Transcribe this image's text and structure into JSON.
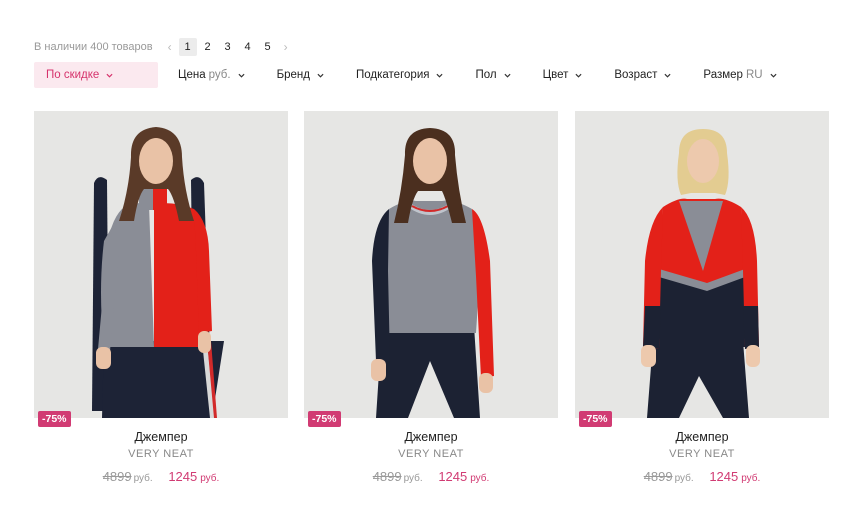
{
  "toolbar": {
    "count_text": "В наличии 400 товаров",
    "prev_arrow": "‹",
    "next_arrow": "›",
    "pages": [
      "1",
      "2",
      "3",
      "4",
      "5"
    ],
    "current_page": "1"
  },
  "filters": [
    {
      "label": "По скидке",
      "unit": ""
    },
    {
      "label": "Цена",
      "unit": "руб."
    },
    {
      "label": "Бренд",
      "unit": ""
    },
    {
      "label": "Подкатегория",
      "unit": ""
    },
    {
      "label": "Пол",
      "unit": ""
    },
    {
      "label": "Цвет",
      "unit": ""
    },
    {
      "label": "Возраст",
      "unit": ""
    },
    {
      "label": "Размер",
      "unit": "RU"
    }
  ],
  "products": [
    {
      "badge": "-75%",
      "name": "Джемпер",
      "brand": "VERY NEAT",
      "old_price": "4899",
      "old_currency": "руб.",
      "new_price": "1245",
      "new_currency": "руб."
    },
    {
      "badge": "-75%",
      "name": "Джемпер",
      "brand": "VERY NEAT",
      "old_price": "4899",
      "old_currency": "руб.",
      "new_price": "1245",
      "new_currency": "руб."
    },
    {
      "badge": "-75%",
      "name": "Джемпер",
      "brand": "VERY NEAT",
      "old_price": "4899",
      "old_currency": "руб.",
      "new_price": "1245",
      "new_currency": "руб."
    }
  ],
  "colors": {
    "accent": "#d13b73",
    "accent_bg": "#fbe9ef",
    "photo_bg": "#e6e6e4"
  },
  "icons": [
    "chevron-left-icon",
    "chevron-right-icon",
    "chevron-down-icon"
  ]
}
